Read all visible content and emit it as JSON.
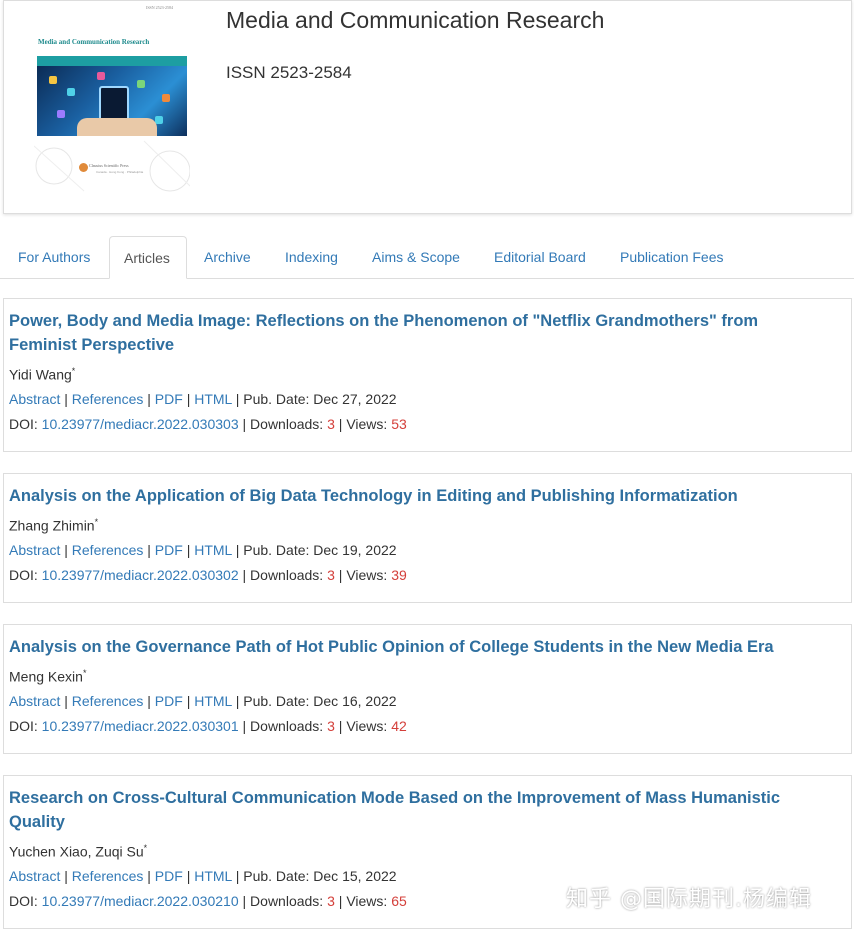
{
  "journal": {
    "title": "Media and Communication Research",
    "issn": "ISSN 2523-2584",
    "cover": {
      "issn": "ISSN 2523-2584",
      "title": "Media and Communication Research",
      "publisher": "Clausius Scientific Press",
      "publisher_sub": "Canada · Hong Kong · Philadelphia"
    }
  },
  "tabs": [
    {
      "label": "For Authors"
    },
    {
      "label": "Articles"
    },
    {
      "label": "Archive"
    },
    {
      "label": "Indexing"
    },
    {
      "label": "Aims & Scope"
    },
    {
      "label": "Editorial Board"
    },
    {
      "label": "Publication Fees"
    }
  ],
  "labels": {
    "abstract": "Abstract",
    "references": "References",
    "pdf": "PDF",
    "html": "HTML",
    "pub_date": "Pub. Date:",
    "doi": "DOI:",
    "downloads": "Downloads:",
    "views": "Views:",
    "sep": "|",
    "star": "*"
  },
  "articles": [
    {
      "title": "Power, Body and Media Image: Reflections on the Phenomenon of \"Netflix Grandmothers\" from Feminist Perspective",
      "authors": "Yidi Wang",
      "pub_date": "Dec 27, 2022",
      "doi": "10.23977/mediacr.2022.030303",
      "downloads": "3",
      "views": "53"
    },
    {
      "title": "Analysis on the Application of Big Data Technology in Editing and Publishing Informatization",
      "authors": "Zhang Zhimin",
      "pub_date": "Dec 19, 2022",
      "doi": "10.23977/mediacr.2022.030302",
      "downloads": "3",
      "views": "39"
    },
    {
      "title": "Analysis on the Governance Path of Hot Public Opinion of College Students in the New Media Era",
      "authors": "Meng Kexin",
      "pub_date": "Dec 16, 2022",
      "doi": "10.23977/mediacr.2022.030301",
      "downloads": "3",
      "views": "42"
    },
    {
      "title": "Research on Cross-Cultural Communication Mode Based on the Improvement of Mass Humanistic Quality",
      "authors": "Yuchen Xiao, Zuqi Su",
      "pub_date": "Dec 15, 2022",
      "doi": "10.23977/mediacr.2022.030210",
      "downloads": "3",
      "views": "65"
    }
  ],
  "watermark": "知乎 @国际期刊.杨编辑"
}
